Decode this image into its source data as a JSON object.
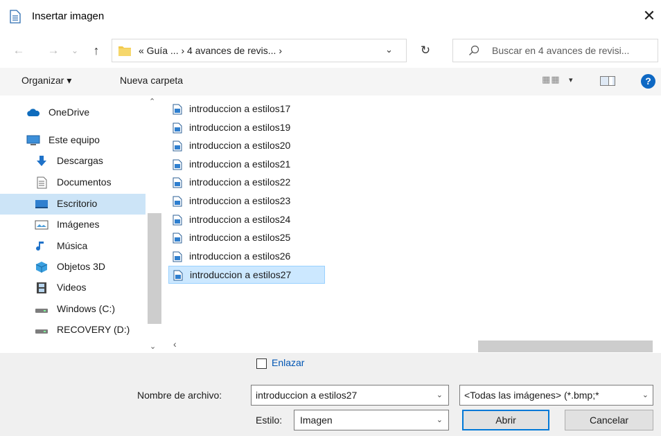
{
  "window": {
    "title": "Insertar imagen",
    "close_glyph": "✕"
  },
  "address": {
    "back_glyph": "←",
    "forward_glyph": "→",
    "recent_glyph": "⌄",
    "up_glyph": "↑",
    "path": "«  Guía ...  ›  4 avances de revis...  ›",
    "drop_glyph": "⌄",
    "refresh_glyph": "↻",
    "search_placeholder": "Buscar en 4 avances de revisi..."
  },
  "toolbar": {
    "organize": "Organizar ▾",
    "new_folder": "Nueva carpeta",
    "views_glyph": "▦▦",
    "views_drop": "▾",
    "help": "?"
  },
  "nav": {
    "items": [
      {
        "label": "OneDrive",
        "icon": "cloud-icon"
      },
      {
        "label": "Este equipo",
        "icon": "computer-icon"
      },
      {
        "label": "Descargas",
        "icon": "download-icon"
      },
      {
        "label": "Documentos",
        "icon": "document-icon"
      },
      {
        "label": "Escritorio",
        "icon": "desktop-icon",
        "selected": true
      },
      {
        "label": "Imágenes",
        "icon": "pictures-icon"
      },
      {
        "label": "Música",
        "icon": "music-icon"
      },
      {
        "label": "Objetos 3D",
        "icon": "cube-icon"
      },
      {
        "label": "Videos",
        "icon": "film-icon"
      },
      {
        "label": "Windows (C:)",
        "icon": "drive-icon"
      },
      {
        "label": "RECOVERY (D:)",
        "icon": "drive-icon"
      }
    ],
    "scroll_up": "⌃",
    "scroll_down": "⌄"
  },
  "files": [
    "introduccion a estilos17",
    "introduccion a estilos19",
    "introduccion a estilos20",
    "introduccion a estilos21",
    "introduccion a estilos22",
    "introduccion a estilos23",
    "introduccion a estilos24",
    "introduccion a estilos25",
    "introduccion a estilos26",
    "introduccion a estilos27"
  ],
  "selected_file_index": 9,
  "hscroll_left": "‹",
  "bottom": {
    "link_label": "Enlazar",
    "filename_label": "Nombre de archivo:",
    "filename_value": "introduccion a estilos27",
    "filter_value": "<Todas las imágenes> (*.bmp;*",
    "style_label": "Estilo:",
    "style_value": "Imagen",
    "open_button": "Abrir",
    "cancel_button": "Cancelar",
    "drop_glyph": "⌄"
  },
  "colors": {
    "selection": "#cce8ff",
    "nav_selection": "#cce4f7",
    "accent": "#0078d7",
    "help_blue": "#0e68c3"
  }
}
